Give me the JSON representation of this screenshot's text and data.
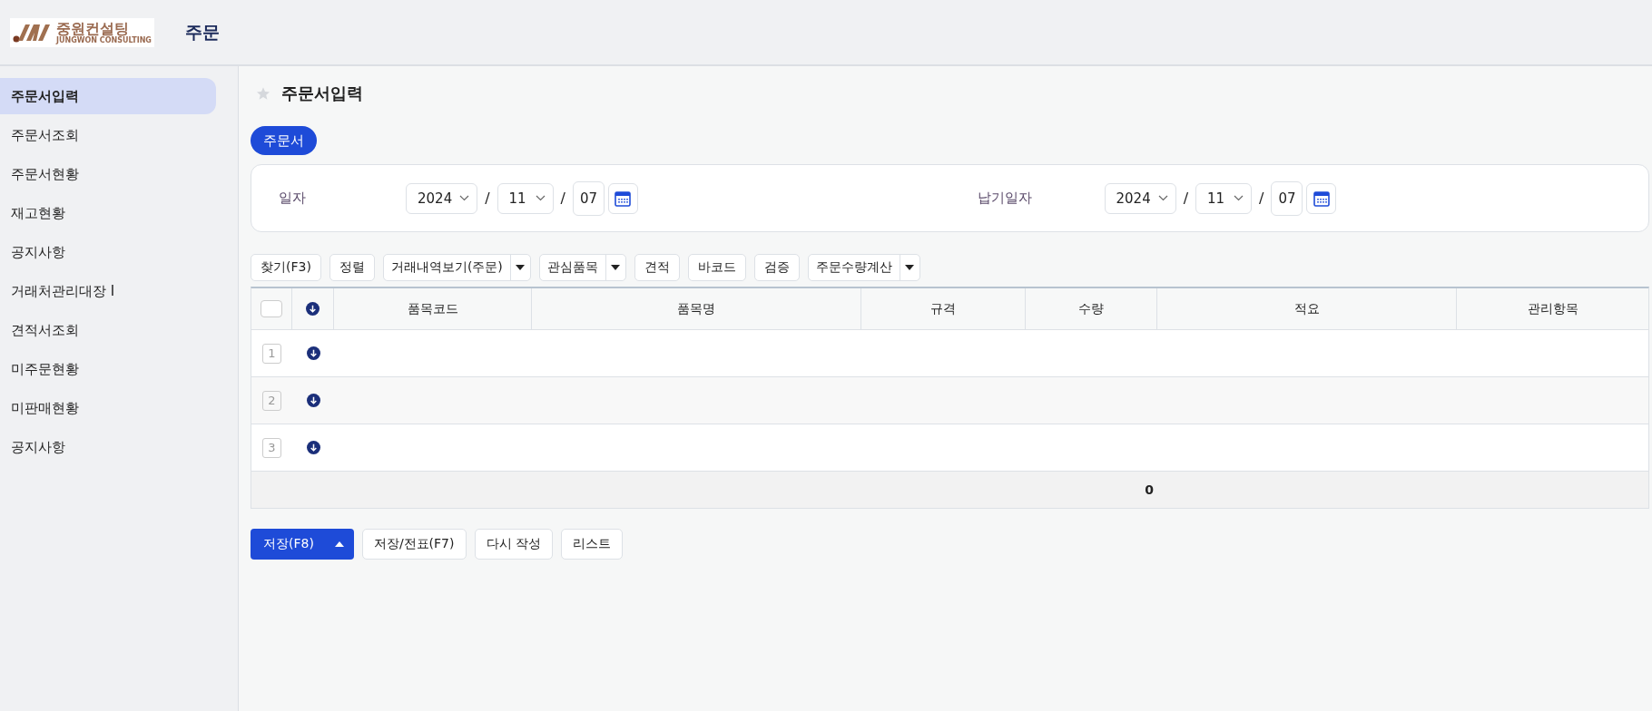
{
  "header": {
    "logo": {
      "name": "중원컨설팅",
      "subtitle": "JUNGWON CONSULTING"
    },
    "title": "주문"
  },
  "sidebar": {
    "items": [
      {
        "label": "주문서입력",
        "selected": true
      },
      {
        "label": "주문서조회",
        "selected": false
      },
      {
        "label": "주문서현황",
        "selected": false
      },
      {
        "label": "재고현황",
        "selected": false
      },
      {
        "label": "공지사항",
        "selected": false
      },
      {
        "label": "거래처관리대장 I",
        "selected": false
      },
      {
        "label": "견적서조회",
        "selected": false
      },
      {
        "label": "미주문현황",
        "selected": false
      },
      {
        "label": "미판매현황",
        "selected": false
      },
      {
        "label": "공지사항",
        "selected": false
      }
    ]
  },
  "page": {
    "title": "주문서입력",
    "favorite": false
  },
  "tabs": [
    {
      "label": "주문서",
      "selected": true
    }
  ],
  "form": {
    "fields": [
      {
        "label": "일자",
        "year": "2024",
        "month": "11",
        "day": "07",
        "separators": [
          "/",
          "/"
        ]
      },
      {
        "label": "납기일자",
        "year": "2024",
        "month": "11",
        "day": "07",
        "separators": [
          "/",
          "/"
        ]
      }
    ]
  },
  "toolbar": [
    {
      "label": "찾기(F3)",
      "kind": "plain"
    },
    {
      "label": "정렬",
      "kind": "plain"
    },
    {
      "label": "거래내역보기(주문)",
      "kind": "split"
    },
    {
      "label": "관심품목",
      "kind": "split"
    },
    {
      "label": "견적",
      "kind": "plain"
    },
    {
      "label": "바코드",
      "kind": "plain"
    },
    {
      "label": "검증",
      "kind": "plain"
    },
    {
      "label": "주문수량계산",
      "kind": "split"
    }
  ],
  "table": {
    "select_all": {
      "checked": false
    },
    "columns": [
      "품목코드",
      "품목명",
      "규격",
      "수량",
      "적요",
      "관리항목"
    ],
    "rows": [
      {
        "number": "1"
      },
      {
        "number": "2"
      },
      {
        "number": "3"
      }
    ],
    "footer": {
      "quantity_total": "0"
    }
  },
  "actions": [
    {
      "label": "저장(F8)",
      "kind": "primary"
    },
    {
      "label": "저장/전표(F7)",
      "kind": "plain"
    },
    {
      "label": "다시 작성",
      "kind": "plain"
    },
    {
      "label": "리스트",
      "kind": "plain"
    }
  ]
}
